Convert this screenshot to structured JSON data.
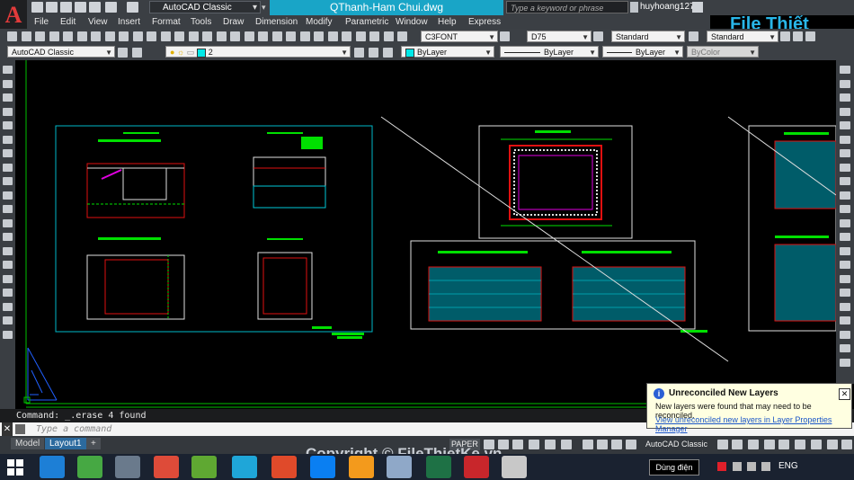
{
  "window": {
    "doc_title": "QThanh-Ham Chui.dwg",
    "workspace": "AutoCAD Classic",
    "search_placeholder": "Type a keyword or phrase",
    "username": "huyhoang127"
  },
  "menus": [
    "File",
    "Edit",
    "View",
    "Insert",
    "Format",
    "Tools",
    "Draw",
    "Dimension",
    "Modify",
    "Parametric",
    "Window",
    "Help",
    "Express"
  ],
  "toolbar1": {
    "text_style": "C3FONT",
    "dim_style": "D75",
    "table_style": "Standard",
    "multileader_style": "Standard"
  },
  "toolbar2": {
    "workspace": "AutoCAD Classic",
    "layer": "2",
    "color": "ByLayer",
    "linetype": "ByLayer",
    "lineweight": "ByLayer",
    "plotstyle": "ByColor"
  },
  "command": {
    "history": "Command: _.erase 4 found",
    "placeholder": "Type a command"
  },
  "layout_tabs": [
    "Model",
    "Layout1"
  ],
  "status": {
    "space": "PAPER",
    "workspace": "AutoCAD Classic"
  },
  "notification": {
    "title": "Unreconciled New Layers",
    "body": "New layers were found that may need to be reconciled.",
    "link": "View unreconciled new layers in Layer Properties Manager"
  },
  "taskbar": {
    "power_label": "Dùng điện",
    "language": "ENG"
  },
  "watermark": {
    "logo": "File Thiết Kế.vn",
    "copyright": "Copyright © FileThietKe.vn"
  },
  "colors": {
    "title_accent": "#19a5c7",
    "cad_green": "#00e000",
    "cad_cyan": "#00c8d8",
    "cad_red": "#e01010",
    "cad_magenta": "#e000e0"
  }
}
